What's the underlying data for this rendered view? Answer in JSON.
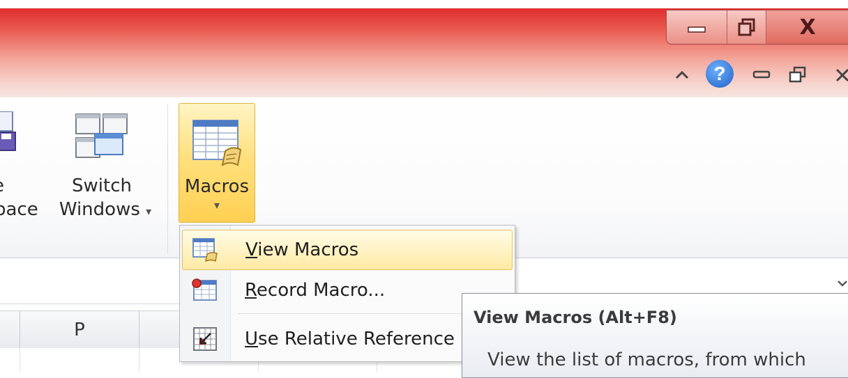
{
  "window": {
    "controls": [
      {
        "name": "minimize",
        "icon": "minimize-icon"
      },
      {
        "name": "restore",
        "icon": "restore-icon"
      },
      {
        "name": "close",
        "icon": "close-icon",
        "label": "X"
      }
    ],
    "workbook_controls": [
      {
        "name": "collapse-ribbon",
        "icon": "chevron-up-icon"
      },
      {
        "name": "help",
        "icon": "help-icon",
        "label": "?"
      },
      {
        "name": "minimize-workbook",
        "icon": "minimize-icon"
      },
      {
        "name": "restore-workbook",
        "icon": "restore-icon"
      },
      {
        "name": "close-workbook",
        "icon": "close-icon"
      }
    ]
  },
  "ribbon": {
    "save_workspace": {
      "line1": "e",
      "line2": "pace",
      "icon": "save-workspace-icon"
    },
    "switch_windows": {
      "line1": "Switch",
      "line2": "Windows",
      "arrow": "▾",
      "icon": "switch-windows-icon"
    },
    "macros": {
      "label": "Macros",
      "arrow": "▾",
      "icon": "macros-icon"
    }
  },
  "macros_menu": {
    "items": [
      {
        "label": "View Macros",
        "accel": "V",
        "rest": "iew Macros",
        "icon": "view-macros-icon",
        "highlighted": true
      },
      {
        "label": "Record Macro...",
        "accel": "R",
        "rest": "ecord Macro...",
        "icon": "record-macro-icon"
      },
      {
        "label": "Use Relative Reference",
        "accel": "U",
        "rest": "se Relative Reference",
        "icon": "relative-reference-icon"
      }
    ]
  },
  "tooltip": {
    "title": "View Macros (Alt+F8)",
    "body": "View the list of macros, from which"
  },
  "sheet": {
    "column_headers": [
      "",
      "P"
    ]
  },
  "colors": {
    "titlebar_red": "#dd2a2a",
    "highlight_gold": "#ffd052",
    "help_blue": "#2f78d6"
  }
}
